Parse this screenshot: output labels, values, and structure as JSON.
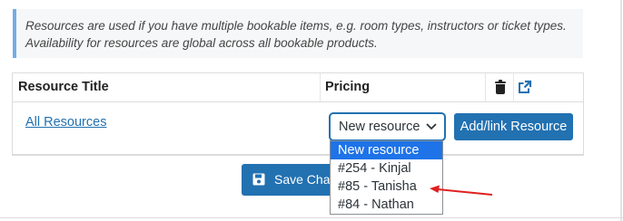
{
  "notice": {
    "line1": "Resources are used if you have multiple bookable items, e.g. room types, instructors or ticket types.",
    "line2": "Availability for resources are global across all bookable products."
  },
  "table": {
    "headers": {
      "resource_title": "Resource Title",
      "pricing": "Pricing",
      "delete_icon": "trash-icon",
      "open_icon": "external-link-icon"
    },
    "row": {
      "resource_link": "All Resources",
      "select_value": "New resource",
      "add_button": "Add/link Resource"
    }
  },
  "dropdown": {
    "options": [
      "New resource",
      "#254 - Kinjal",
      "#85 - Tanisha",
      "#84 - Nathan"
    ],
    "selected_index": 0
  },
  "footer": {
    "save_button": "Save Changes",
    "save_icon": "floppy-disk-icon"
  },
  "colors": {
    "accent": "#2271b1",
    "annotation_arrow": "#e02020",
    "notice_border": "#72aee6",
    "option_highlight": "#1e73e8"
  }
}
